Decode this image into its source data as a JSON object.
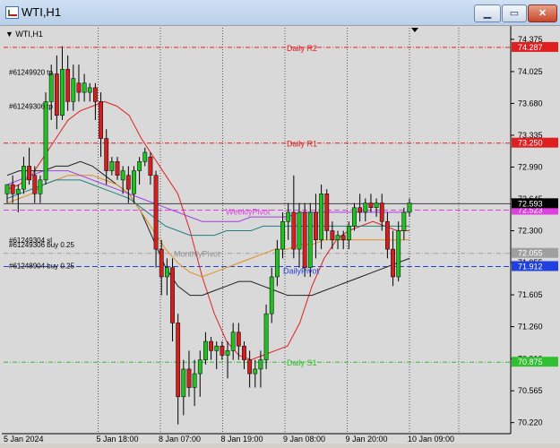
{
  "window": {
    "title": "WTI,H1",
    "min_label": "▁",
    "max_label": "▭",
    "close_label": "✕"
  },
  "chart_header": {
    "label": "WTI,H1"
  },
  "chart_data": {
    "type": "candlestick",
    "symbol": "WTI",
    "timeframe": "H1",
    "ylim": [
      70.1,
      74.5
    ],
    "price_ticks": [
      "74.375",
      "74.025",
      "73.680",
      "73.335",
      "72.990",
      "72.645",
      "72.300",
      "71.955",
      "71.605",
      "71.260",
      "70.910",
      "70.565",
      "70.220"
    ],
    "time_ticks": [
      "5 Jan 2024",
      "5 Jan 18:00",
      "8 Jan 07:00",
      "8 Jan 19:00",
      "9 Jan 08:00",
      "9 Jan 20:00",
      "10 Jan 09:00"
    ],
    "pivot_lines": [
      {
        "label": "Daily R2",
        "price": 74.287,
        "color": "#e02020",
        "tag": "74.287"
      },
      {
        "label": "Daily R1",
        "price": 73.25,
        "color": "#e02020",
        "tag": "73.250"
      },
      {
        "label": "WeeklyPivot",
        "price": 72.523,
        "color": "#e040e0",
        "tag": "72.523"
      },
      {
        "label": "MonthlyPivot",
        "price": 72.055,
        "color": "#a0a0a0",
        "tag": "72.055"
      },
      {
        "label": "DailyPivot",
        "price": 71.912,
        "color": "#2040e0",
        "tag": "71.912"
      },
      {
        "label": "Daily S1",
        "price": 70.875,
        "color": "#30c030",
        "tag": "70.875"
      }
    ],
    "current_price": {
      "value": 72.593,
      "tag": "72.593"
    },
    "order_labels": [
      {
        "text": "#61249920 tp",
        "price": 74.02
      },
      {
        "text": "#61249306 tp",
        "price": 73.65
      },
      {
        "text": "#61249304 sl",
        "price": 72.2
      },
      {
        "text": "#61249306 buy 0.25",
        "price": 72.15
      },
      {
        "text": "#61248904 buy 0.25",
        "price": 71.92
      }
    ],
    "candles": [
      [
        72.7,
        72.8,
        72.6,
        72.8
      ],
      [
        72.8,
        72.9,
        72.6,
        72.7
      ],
      [
        72.7,
        72.8,
        72.5,
        72.75
      ],
      [
        72.75,
        73.1,
        72.7,
        73.0
      ],
      [
        73.0,
        73.2,
        72.8,
        72.85
      ],
      [
        72.9,
        73.0,
        72.6,
        72.7
      ],
      [
        72.7,
        72.9,
        72.6,
        72.85
      ],
      [
        72.85,
        73.8,
        72.8,
        73.7
      ],
      [
        73.7,
        74.1,
        73.5,
        74.0
      ],
      [
        74.0,
        74.2,
        73.4,
        73.55
      ],
      [
        73.55,
        74.3,
        73.5,
        74.05
      ],
      [
        74.05,
        74.2,
        73.6,
        73.7
      ],
      [
        73.7,
        74.1,
        73.6,
        73.95
      ],
      [
        73.9,
        74.1,
        73.7,
        73.8
      ],
      [
        73.8,
        74.0,
        73.7,
        73.9
      ],
      [
        73.8,
        73.9,
        73.7,
        73.85
      ],
      [
        73.85,
        73.9,
        73.5,
        73.7
      ],
      [
        73.7,
        73.8,
        73.1,
        73.3
      ],
      [
        73.3,
        73.4,
        72.8,
        72.95
      ],
      [
        72.95,
        73.1,
        72.9,
        73.05
      ],
      [
        73.05,
        73.1,
        72.85,
        72.9
      ],
      [
        72.85,
        73.0,
        72.7,
        72.95
      ],
      [
        72.9,
        73.0,
        72.6,
        72.75
      ],
      [
        72.7,
        73.0,
        72.6,
        72.95
      ],
      [
        72.95,
        73.1,
        72.8,
        73.05
      ],
      [
        73.05,
        73.2,
        73.0,
        73.15
      ],
      [
        73.1,
        73.15,
        72.8,
        72.9
      ],
      [
        72.9,
        72.95,
        71.9,
        72.1
      ],
      [
        72.1,
        72.2,
        71.6,
        71.8
      ],
      [
        71.8,
        72.0,
        71.6,
        71.9
      ],
      [
        71.9,
        72.0,
        71.1,
        71.3
      ],
      [
        71.3,
        71.4,
        70.2,
        70.5
      ],
      [
        70.5,
        70.9,
        70.3,
        70.8
      ],
      [
        70.8,
        71.0,
        70.5,
        70.6
      ],
      [
        70.6,
        70.9,
        70.4,
        70.75
      ],
      [
        70.75,
        71.0,
        70.5,
        70.9
      ],
      [
        70.9,
        71.2,
        70.85,
        71.1
      ],
      [
        71.1,
        71.15,
        70.9,
        71.0
      ],
      [
        71.0,
        71.1,
        70.8,
        71.05
      ],
      [
        71.05,
        71.1,
        70.9,
        70.95
      ],
      [
        70.95,
        71.1,
        70.7,
        71.0
      ],
      [
        71.0,
        71.3,
        70.9,
        71.2
      ],
      [
        71.2,
        71.3,
        70.9,
        71.05
      ],
      [
        71.05,
        71.1,
        70.8,
        70.9
      ],
      [
        70.9,
        71.0,
        70.6,
        70.75
      ],
      [
        70.75,
        70.9,
        70.6,
        70.8
      ],
      [
        70.8,
        71.0,
        70.6,
        70.9
      ],
      [
        70.9,
        71.5,
        70.8,
        71.4
      ],
      [
        71.4,
        71.9,
        71.3,
        71.8
      ],
      [
        71.8,
        72.2,
        71.7,
        72.1
      ],
      [
        72.1,
        72.5,
        72.0,
        72.4
      ],
      [
        72.4,
        72.6,
        72.2,
        72.5
      ],
      [
        72.5,
        72.9,
        72.0,
        72.1
      ],
      [
        72.1,
        72.6,
        71.9,
        72.5
      ],
      [
        72.5,
        72.6,
        71.8,
        71.9
      ],
      [
        71.9,
        72.6,
        71.8,
        72.5
      ],
      [
        72.5,
        72.7,
        72.0,
        72.2
      ],
      [
        72.2,
        72.8,
        72.1,
        72.7
      ],
      [
        72.7,
        72.75,
        72.2,
        72.3
      ],
      [
        72.3,
        72.4,
        72.1,
        72.2
      ],
      [
        72.2,
        72.3,
        72.1,
        72.25
      ],
      [
        72.25,
        72.3,
        72.1,
        72.2
      ],
      [
        72.2,
        72.4,
        72.1,
        72.35
      ],
      [
        72.35,
        72.6,
        72.3,
        72.55
      ],
      [
        72.55,
        72.7,
        72.4,
        72.5
      ],
      [
        72.5,
        72.65,
        72.4,
        72.6
      ],
      [
        72.6,
        72.7,
        72.5,
        72.55
      ],
      [
        72.55,
        72.65,
        72.45,
        72.6
      ],
      [
        72.6,
        72.7,
        72.3,
        72.4
      ],
      [
        72.4,
        72.5,
        72.0,
        72.1
      ],
      [
        72.1,
        72.3,
        71.7,
        71.8
      ],
      [
        71.8,
        72.4,
        71.75,
        72.3
      ],
      [
        72.3,
        72.55,
        72.2,
        72.5
      ],
      [
        72.5,
        72.65,
        72.45,
        72.6
      ]
    ],
    "moving_averages": [
      {
        "name": "",
        "color": "#e02020",
        "values": [
          72.75,
          72.8,
          72.9,
          73.1,
          73.3,
          73.5,
          73.6,
          73.65,
          73.7,
          73.65,
          73.55,
          73.3,
          73.1,
          72.9,
          72.7,
          72.3,
          71.8,
          71.4,
          71.1,
          70.95,
          70.9,
          70.95,
          71.0,
          71.05,
          71.3,
          71.7,
          72.0,
          72.2,
          72.3,
          72.35,
          72.4,
          72.35,
          72.3,
          72.3
        ]
      },
      {
        "name": "",
        "color": "#202020",
        "values": [
          72.9,
          72.95,
          72.95,
          72.95,
          73.0,
          73.0,
          73.05,
          73.0,
          72.9,
          72.8,
          72.7,
          72.5,
          72.2,
          71.9,
          71.7,
          71.6,
          71.6,
          71.65,
          71.7,
          71.75,
          71.75,
          71.7,
          71.65,
          71.6,
          71.6,
          71.6,
          71.65,
          71.7,
          71.75,
          71.8,
          71.85,
          71.9,
          71.95,
          72.0
        ]
      },
      {
        "name": "",
        "color": "#e09020",
        "values": [
          72.6,
          72.65,
          72.7,
          72.8,
          72.85,
          72.9,
          72.9,
          72.9,
          72.85,
          72.8,
          72.7,
          72.5,
          72.3,
          72.1,
          71.95,
          71.85,
          71.8,
          71.85,
          71.9,
          71.95,
          72.0,
          72.05,
          72.1,
          72.1,
          72.15,
          72.15,
          72.2,
          72.2,
          72.2,
          72.2,
          72.2,
          72.2,
          72.2,
          72.2
        ]
      },
      {
        "name": "",
        "color": "#208080",
        "values": [
          72.65,
          72.7,
          72.75,
          72.8,
          72.85,
          72.85,
          72.85,
          72.8,
          72.75,
          72.7,
          72.65,
          72.55,
          72.45,
          72.35,
          72.3,
          72.25,
          72.25,
          72.25,
          72.3,
          72.3,
          72.3,
          72.35,
          72.35,
          72.35,
          72.35,
          72.35,
          72.35,
          72.35,
          72.35,
          72.35,
          72.35,
          72.35,
          72.35,
          72.35
        ]
      },
      {
        "name": "",
        "color": "#a040e0",
        "values": [
          72.8,
          72.85,
          72.9,
          72.95,
          72.95,
          72.95,
          72.9,
          72.85,
          72.8,
          72.75,
          72.7,
          72.65,
          72.6,
          72.55,
          72.5,
          72.45,
          72.4,
          72.4,
          72.4,
          72.4,
          72.45,
          72.45,
          72.45,
          72.45,
          72.5,
          72.5,
          72.5,
          72.5,
          72.5,
          72.5,
          72.5,
          72.5,
          72.5,
          72.5
        ]
      }
    ],
    "colors": {
      "bull": "#20c020",
      "bear": "#d02020",
      "wick": "#000000",
      "background": "#d9d9d9",
      "grid": "#000000"
    }
  }
}
